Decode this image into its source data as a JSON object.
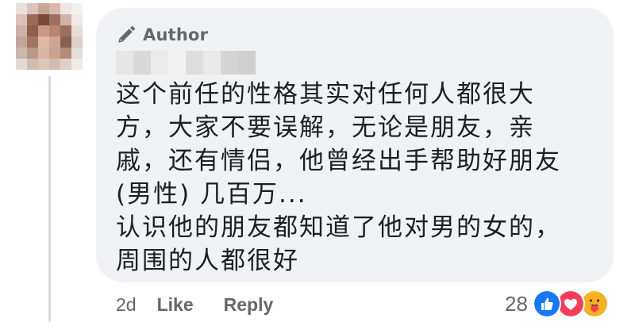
{
  "comment": {
    "badge_label": "Author",
    "badge_icon": "pen-icon",
    "author_name_redacted": true,
    "lines": [
      "这个前任的性格其实对任何人都很大",
      "方，大家不要误解，无论是朋友，亲",
      "戚，还有情侣，他曾经出手帮助好朋友",
      "(男性) 几百万...",
      "认识他的朋友都知道了他对男的女的，",
      "周围的人都很好"
    ]
  },
  "actions": {
    "time": "2d",
    "like_label": "Like",
    "reply_label": "Reply"
  },
  "reactions": {
    "count": "28",
    "icons": [
      "like-reaction-icon",
      "love-reaction-icon",
      "care-reaction-icon"
    ]
  },
  "colors": {
    "bubble_bg": "#f0f2f5",
    "muted_text": "#65676b",
    "body_text": "#1c1e21",
    "like_blue": "#1877f2",
    "love_red": "#f33e58",
    "care_yellow": "#f7b125"
  }
}
